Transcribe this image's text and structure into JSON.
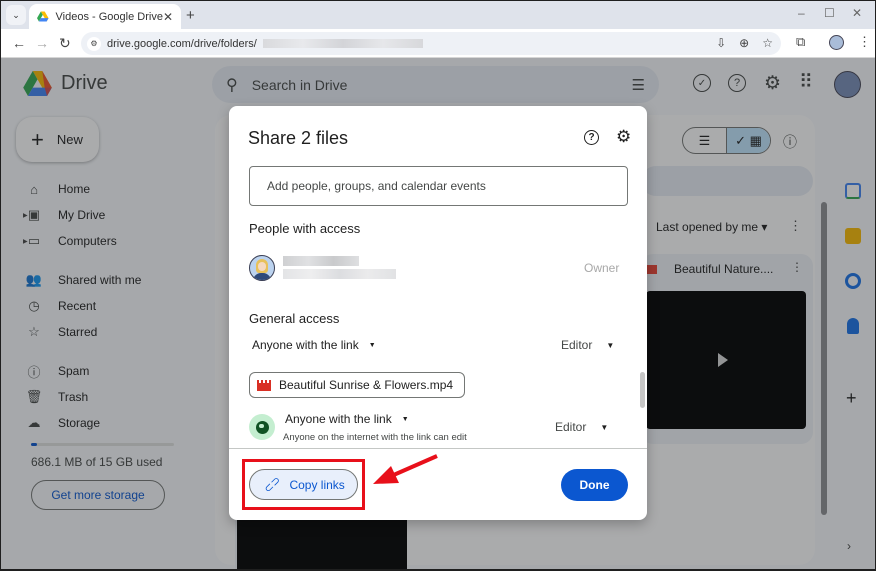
{
  "browser": {
    "tab_title": "Videos - Google Drive",
    "url": "drive.google.com/drive/folders/",
    "icons": [
      "tab-search-icon",
      "drive-favicon",
      "close-tab-icon",
      "new-tab-icon",
      "minimize-icon",
      "maximize-icon",
      "close-window-icon",
      "back-icon",
      "forward-icon",
      "reload-icon",
      "site-info-icon",
      "install-app-icon",
      "zoom-icon",
      "bookmark-star-icon",
      "extensions-icon",
      "profile-avatar",
      "menu-kebab-icon"
    ],
    "glyphs": {
      "tab_menu": "⌄",
      "close": "✕",
      "new_tab": "+",
      "minimize": "–",
      "maximize": "☐",
      "close_window": "✕",
      "back": "←",
      "forward": "→",
      "reload": "↻",
      "site_info": "⚙",
      "install": "⇩",
      "zoom": "⊕",
      "star": "☆",
      "ext": "⧉",
      "kebab": "⋮"
    }
  },
  "drive": {
    "app_name": "Drive",
    "search_placeholder": "Search in Drive",
    "header_glyphs": {
      "search": "⚲",
      "filter": "☰",
      "offline": "✓",
      "help": "?",
      "settings": "⚙",
      "apps": "⠿"
    },
    "new_button": {
      "icon": "+",
      "label": "New"
    },
    "sidebar": [
      {
        "label": "Home",
        "icon": "⌂",
        "name": "home",
        "expandable": false
      },
      {
        "label": "My Drive",
        "icon": "▣",
        "name": "my-drive",
        "expandable": true
      },
      {
        "label": "Computers",
        "icon": "▭",
        "name": "computers",
        "expandable": true
      },
      {
        "label": "Shared with me",
        "icon": "👥",
        "name": "shared-with-me",
        "expandable": false
      },
      {
        "label": "Recent",
        "icon": "◷",
        "name": "recent",
        "expandable": false
      },
      {
        "label": "Starred",
        "icon": "☆",
        "name": "starred",
        "expandable": false
      },
      {
        "label": "Spam",
        "icon": "ⓘ",
        "name": "spam",
        "expandable": false
      },
      {
        "label": "Trash",
        "icon": "🗑",
        "name": "trash",
        "expandable": false
      },
      {
        "label": "Storage",
        "icon": "☁",
        "name": "storage",
        "expandable": false
      }
    ],
    "storage": {
      "used_text": "686.1 MB of 15 GB used",
      "used_fraction": 0.045,
      "get_more_label": "Get more storage"
    },
    "view_toggle": {
      "list_glyph": "☰",
      "grid_glyph": "✓ ▦",
      "selected": "grid"
    },
    "info_glyph": "ⓘ",
    "sort_label": "Last opened by me ▾",
    "kebab_glyph": "⋮",
    "files": [
      {
        "name": "Beautiful Nature....",
        "type": "video"
      }
    ],
    "side_panel_apps": [
      {
        "name": "calendar",
        "color": "#4285f4"
      },
      {
        "name": "keep",
        "color": "#fbbc04"
      },
      {
        "name": "tasks",
        "color": "#1a73e8"
      },
      {
        "name": "contacts",
        "color": "#1a73e8"
      }
    ],
    "side_plus_glyph": "+",
    "side_chevron_glyph": "›"
  },
  "share_dialog": {
    "title": "Share 2 files",
    "help_glyph": "?",
    "settings_glyph": "⚙",
    "add_people_placeholder": "Add people, groups, and calendar events",
    "people_section_title": "People with access",
    "owner_role": "Owner",
    "general_access_title": "General access",
    "general_access_value": "Anyone with the link",
    "general_role": "Editor",
    "caret_glyph": "▼",
    "file_chip_name": "Beautiful Sunrise & Flowers.mp4",
    "file_access_value": "Anyone with the link",
    "file_access_description": "Anyone on the internet with the link can edit",
    "file_role": "Editor",
    "copy_links_label": "Copy links",
    "link_glyph": "⊂⊃",
    "done_label": "Done"
  },
  "colors": {
    "accent": "#0b57d0",
    "annotation_red": "#e8101a",
    "globe_bg": "#c4eed0"
  }
}
